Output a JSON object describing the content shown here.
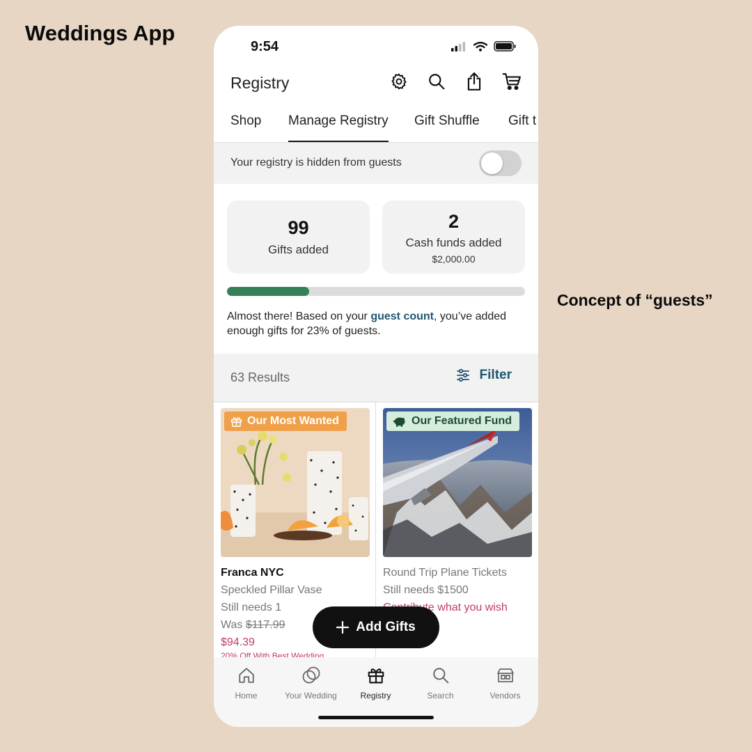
{
  "labels": {
    "app_title": "Weddings App",
    "concept_note": "Concept of “guests”"
  },
  "status_bar": {
    "time": "9:54"
  },
  "header": {
    "title": "Registry",
    "icons": [
      "gear-icon",
      "search-icon",
      "share-icon",
      "cart-icon"
    ]
  },
  "tabs": [
    {
      "label": "Shop",
      "active": false
    },
    {
      "label": "Manage Registry",
      "active": true
    },
    {
      "label": "Gift Shuffle",
      "active": false
    },
    {
      "label": "Gift t",
      "active": false
    }
  ],
  "visibility": {
    "text": "Your registry is hidden from guests",
    "toggle_on": false
  },
  "stats": {
    "gifts": {
      "count": "99",
      "label": "Gifts added"
    },
    "cash": {
      "count": "2",
      "label": "Cash funds added",
      "amount": "$2,000.00"
    }
  },
  "progress": {
    "percent": 23,
    "note_before": "Almost there! Based on your ",
    "note_link": "guest count",
    "note_after": ", you’ve added enough gifts for 23% of guests."
  },
  "results": {
    "count_label": "63 Results",
    "filter_label": "Filter"
  },
  "products": [
    {
      "badge": "Our Most Wanted",
      "brand": "Franca NYC",
      "name": "Speckled Pillar Vase",
      "needs": "Still needs 1",
      "was_label": "Was ",
      "was_price": "$117.99",
      "price": "$94.39",
      "promo": "20% Off With Best Wedding"
    },
    {
      "badge": "Our Featured Fund",
      "name": "Round Trip Plane Tickets",
      "needs": "Still needs $1500",
      "cta": "Contribute what you wish"
    }
  ],
  "add_gifts_label": "Add Gifts",
  "bottom_nav": [
    {
      "label": "Home",
      "icon": "home-icon"
    },
    {
      "label": "Your Wedding",
      "icon": "rings-icon"
    },
    {
      "label": "Registry",
      "icon": "gift-icon",
      "active": true
    },
    {
      "label": "Search",
      "icon": "search-icon"
    },
    {
      "label": "Vendors",
      "icon": "storefront-icon"
    }
  ],
  "colors": {
    "background": "#e6d6c3",
    "progress": "#37815a",
    "link": "#1f5670",
    "sale": "#c03b69",
    "badge_wanted": "#f0a048",
    "badge_fund": "#d4eedb"
  }
}
